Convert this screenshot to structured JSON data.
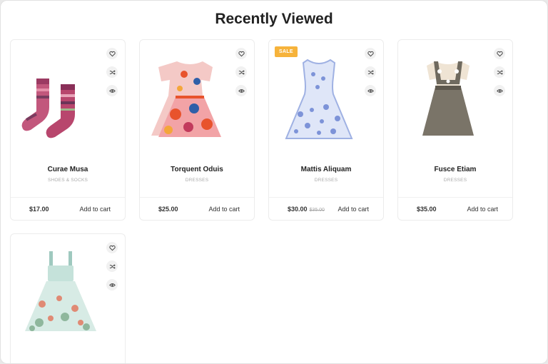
{
  "section": {
    "title": "Recently Viewed"
  },
  "products": [
    {
      "name": "Curae Musa",
      "category": "SHOES & SOCKS",
      "price": "$17.00",
      "old_price": "",
      "sale": false,
      "image": "socks"
    },
    {
      "name": "Torquent Oduis",
      "category": "DRESSES",
      "price": "$25.00",
      "old_price": "",
      "sale": false,
      "image": "floral-dress"
    },
    {
      "name": "Mattis Aliquam",
      "category": "DRESSES",
      "price": "$30.00",
      "old_price": "$35.00",
      "sale": true,
      "image": "blue-dress"
    },
    {
      "name": "Fusce Etiam",
      "category": "DRESSES",
      "price": "$35.00",
      "old_price": "",
      "sale": false,
      "image": "pinafore-dress"
    },
    {
      "name": "",
      "category": "",
      "price": "",
      "old_price": "",
      "sale": false,
      "image": "mint-dress"
    }
  ],
  "labels": {
    "add_to_cart": "Add to cart",
    "sale_badge": "SALE"
  },
  "icons": {
    "wishlist": "heart-icon",
    "compare": "shuffle-icon",
    "quickview": "eye-icon"
  },
  "colors": {
    "sale_badge": "#f6b33b",
    "text": "#222222",
    "muted": "#aaaaaa"
  }
}
